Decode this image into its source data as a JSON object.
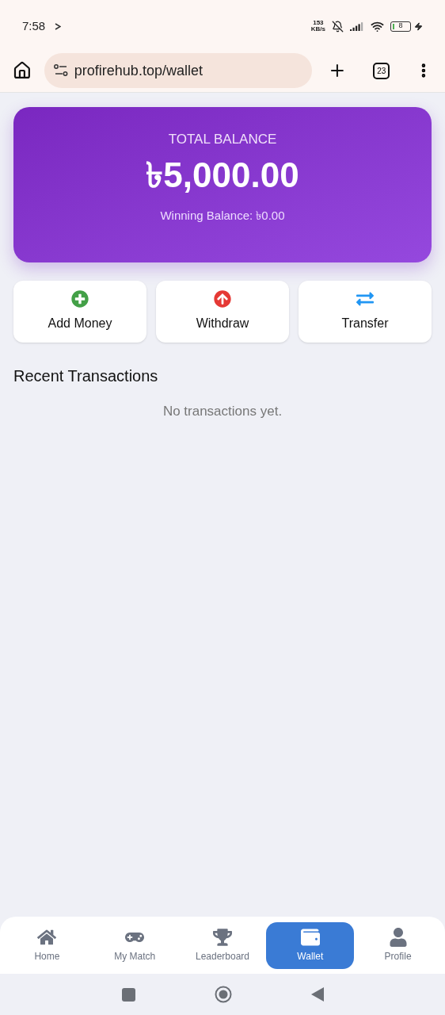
{
  "status_bar": {
    "time": "7:58",
    "speed_value": "153",
    "speed_unit": "KB/s",
    "battery": "8"
  },
  "browser": {
    "url": "profirehub.top/wallet",
    "tab_count": "23"
  },
  "balance_card": {
    "title": "TOTAL BALANCE",
    "amount": "৳5,000.00",
    "winning": "Winning Balance: ৳0.00"
  },
  "actions": [
    {
      "label": "Add Money"
    },
    {
      "label": "Withdraw"
    },
    {
      "label": "Transfer"
    }
  ],
  "recent": {
    "heading": "Recent Transactions",
    "empty": "No transactions yet."
  },
  "bottom_nav": [
    {
      "label": "Home",
      "selected": false
    },
    {
      "label": "My Match",
      "selected": false
    },
    {
      "label": "Leaderboard",
      "selected": false
    },
    {
      "label": "Wallet",
      "selected": true
    },
    {
      "label": "Profile",
      "selected": false
    }
  ]
}
